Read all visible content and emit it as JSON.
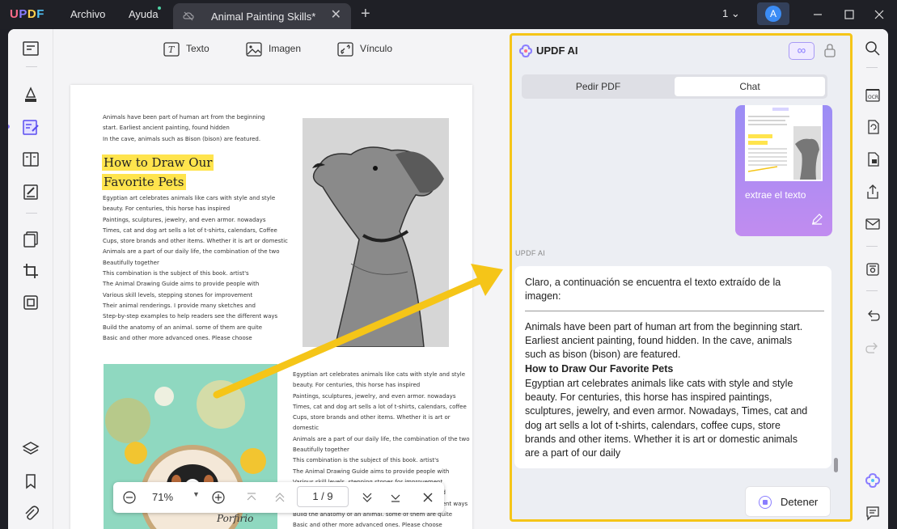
{
  "app": {
    "logo": "UPDF",
    "menu": [
      "Archivo",
      "Ayuda"
    ],
    "tab_title": "Animal Painting Skills*",
    "window_count": "1"
  },
  "user": {
    "avatar_letter": "A"
  },
  "toolbar": {
    "text_label": "Texto",
    "image_label": "Imagen",
    "link_label": "Vínculo"
  },
  "document": {
    "intro": [
      "Animals have been part of human art from the beginning",
      "start. Earliest ancient painting, found hidden",
      "In the cave, animals such as Bison (bison) are featured."
    ],
    "heading_line1": "How to Draw Our",
    "heading_line2": "Favorite Pets",
    "left_body": [
      "Egyptian art celebrates animals like cars with style and style",
      "beauty. For centuries, this horse has inspired",
      "Paintings, sculptures, jewelry, and even armor. nowadays",
      "Times, cat and dog art sells a lot of t-shirts, calendars, Coffee",
      "Cups, store brands and other items. Whether it is art or domestic",
      "Animals are a part of our daily life, the combination of the two",
      "Beautifully together",
      "This combination is the subject of this book. artist's",
      "The Animal Drawing Guide aims to provide people with",
      "Various skill levels, stepping stones for improvement",
      "Their animal renderings. I provide many sketches and",
      "Step-by-step examples to help readers see the different ways",
      "Build the anatomy of an animal. some of them are quite",
      "Basic and other more advanced ones. Please choose"
    ],
    "right_body": [
      "Egyptian art celebrates animals like cats with style and style",
      "beauty. For centuries, this horse has inspired",
      "Paintings, sculptures, jewelry, and even armor. nowadays",
      "Times, cat and dog art sells a lot of t-shirts, calendars, coffee",
      "Cups, store brands and other items. Whether it is art or domestic",
      "Animals are a part of our daily life, the combination of the two",
      "Beautifully together",
      "This combination is the subject of this book. artist's",
      "The Animal Drawing Guide aims to provide people with",
      "Various skill levels, stepping stones for improvement",
      "Their animal renderings. I provide many sketches and",
      "Step-by-step examples to help readers see the different ways",
      "Build the anatomy of an animal. some of them are quite",
      "Basic and other more advanced ones. Please choose"
    ],
    "photo_caption": "Porfirio"
  },
  "pagenav": {
    "zoom": "71%",
    "page_indicator": "1 / 9"
  },
  "ai": {
    "title": "UPDF AI",
    "tab_pdf": "Pedir PDF",
    "tab_chat": "Chat",
    "user_message": "extrae el texto",
    "sender_label": "UPDF AI",
    "reply_intro": [
      "Claro, a continuación se encuentra el texto extraído de la",
      "imagen:"
    ],
    "reply_para1": [
      "Animals have been part of human art from the beginning start.",
      "Earliest ancient painting, found hidden. In the cave, animals",
      "such as bison (bison) are featured."
    ],
    "reply_heading": "How to Draw Our Favorite Pets",
    "reply_para2": [
      "Egyptian art celebrates animals like cats with style and style",
      "beauty. For centuries, this horse has inspired paintings,",
      "sculptures, jewelry, and even armor. Nowadays, Times, cat and",
      "dog art sells a lot of t-shirts, calendars, coffee cups, store",
      "brands and other items. Whether it is art or domestic animals",
      "are a part of our daily"
    ],
    "stop_label": "Detener"
  },
  "colors": {
    "accent": "#8a7dff",
    "highlight": "#ffe44d",
    "annotation_arrow": "#f5c518",
    "panel_border": "#f5c518"
  }
}
